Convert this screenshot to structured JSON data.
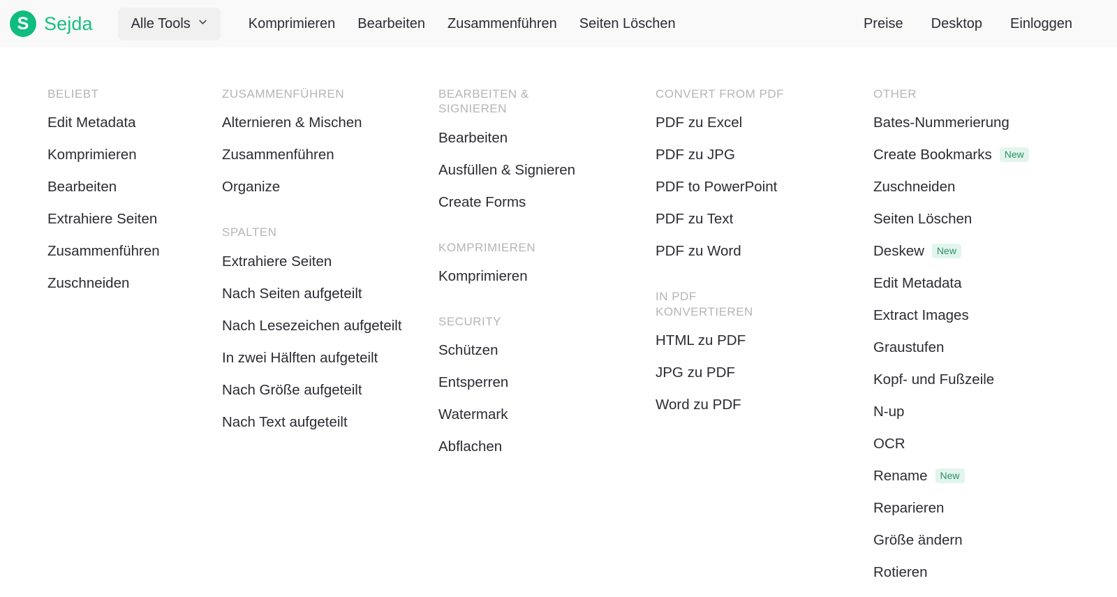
{
  "header": {
    "logo_letter": "S",
    "brand": "Sejda",
    "brand_color": "#17c07e",
    "all_tools_label": "Alle Tools",
    "chevron_icon": "chevron-down-icon",
    "nav_left": [
      {
        "label": "Komprimieren"
      },
      {
        "label": "Bearbeiten"
      },
      {
        "label": "Zusammenführen"
      },
      {
        "label": "Seiten Löschen"
      }
    ],
    "nav_right": [
      {
        "label": "Preise"
      },
      {
        "label": "Desktop"
      },
      {
        "label": "Einloggen"
      }
    ]
  },
  "menu": {
    "columns": [
      {
        "groups": [
          {
            "title": "BELIEBT",
            "items": [
              {
                "label": "Edit Metadata"
              },
              {
                "label": "Komprimieren"
              },
              {
                "label": "Bearbeiten"
              },
              {
                "label": "Extrahiere Seiten"
              },
              {
                "label": "Zusammenführen"
              },
              {
                "label": "Zuschneiden"
              }
            ]
          }
        ]
      },
      {
        "groups": [
          {
            "title": "ZUSAMMENFÜHREN",
            "items": [
              {
                "label": "Alternieren & Mischen"
              },
              {
                "label": "Zusammenführen"
              },
              {
                "label": "Organize"
              }
            ]
          },
          {
            "title": "SPALTEN",
            "items": [
              {
                "label": "Extrahiere Seiten"
              },
              {
                "label": "Nach Seiten aufgeteilt"
              },
              {
                "label": "Nach Lesezeichen aufgeteilt"
              },
              {
                "label": "In zwei Hälften aufgeteilt"
              },
              {
                "label": "Nach Größe aufgeteilt"
              },
              {
                "label": "Nach Text aufgeteilt"
              }
            ]
          }
        ]
      },
      {
        "groups": [
          {
            "title": "BEARBEITEN & SIGNIEREN",
            "items": [
              {
                "label": "Bearbeiten"
              },
              {
                "label": "Ausfüllen & Signieren"
              },
              {
                "label": "Create Forms"
              }
            ]
          },
          {
            "title": "KOMPRIMIEREN",
            "items": [
              {
                "label": "Komprimieren"
              }
            ]
          },
          {
            "title": "SECURITY",
            "items": [
              {
                "label": "Schützen"
              },
              {
                "label": "Entsperren"
              },
              {
                "label": "Watermark"
              },
              {
                "label": "Abflachen"
              }
            ]
          }
        ]
      },
      {
        "groups": [
          {
            "title": "CONVERT FROM PDF",
            "items": [
              {
                "label": "PDF zu Excel"
              },
              {
                "label": "PDF zu JPG"
              },
              {
                "label": "PDF to PowerPoint"
              },
              {
                "label": "PDF zu Text"
              },
              {
                "label": "PDF zu Word"
              }
            ]
          },
          {
            "title": "IN PDF KONVERTIEREN",
            "items": [
              {
                "label": "HTML zu PDF"
              },
              {
                "label": "JPG zu PDF"
              },
              {
                "label": "Word zu PDF"
              }
            ]
          }
        ]
      },
      {
        "groups": [
          {
            "title": "OTHER",
            "items": [
              {
                "label": "Bates-Nummerierung"
              },
              {
                "label": "Create Bookmarks",
                "badge": "New"
              },
              {
                "label": "Zuschneiden"
              },
              {
                "label": "Seiten Löschen"
              },
              {
                "label": "Deskew",
                "badge": "New"
              },
              {
                "label": "Edit Metadata"
              },
              {
                "label": "Extract Images"
              },
              {
                "label": "Graustufen"
              },
              {
                "label": "Kopf- und Fußzeile"
              },
              {
                "label": "N-up"
              },
              {
                "label": "OCR"
              },
              {
                "label": "Rename",
                "badge": "New"
              },
              {
                "label": "Reparieren"
              },
              {
                "label": "Größe ändern"
              },
              {
                "label": "Rotieren"
              }
            ]
          }
        ]
      }
    ]
  }
}
